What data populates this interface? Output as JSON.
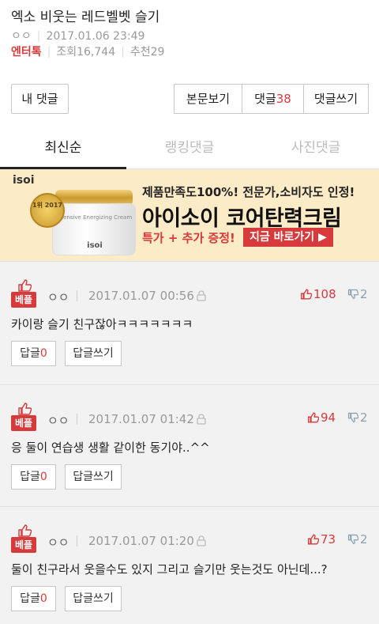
{
  "post": {
    "title": "엑소 비웃는 레드벨벳 슬기",
    "author": "ㅇㅇ",
    "datetime": "2017.01.06 23:49",
    "category": "엔터톡",
    "views_label": "조회16,744",
    "recommend_label": "추천29"
  },
  "buttons": {
    "my_comments": "내 댓글",
    "view_body": "본문보기",
    "comments_label": "댓글",
    "comments_count": "38",
    "write_comment": "댓글쓰기"
  },
  "tabs": [
    {
      "label": "최신순",
      "active": true
    },
    {
      "label": "랭킹댓글",
      "active": false
    },
    {
      "label": "사진댓글",
      "active": false
    }
  ],
  "ad": {
    "brand": "isoi",
    "badge_text": "1위 2017",
    "jar_label": "Intensive Energizing Cream",
    "jar_brand": "isoi",
    "line1": "제품만족도100%! 전문가,소비자도 인정!",
    "line2": "아이소이 코어탄력크림",
    "line3": "특가 + 추가 증정!",
    "cta": "지금 바로가기 ▶"
  },
  "comments": [
    {
      "badge": "베플",
      "author": "ㅇㅇ",
      "datetime": "2017.01.07 00:56",
      "likes": "108",
      "dislikes": "2",
      "text": "카이랑 슬기 친구잖아ㅋㅋㅋㅋㅋㅋㅋ",
      "reply_label": "답글",
      "reply_count": "0",
      "write_reply": "답글쓰기"
    },
    {
      "badge": "베플",
      "author": "ㅇㅇ",
      "datetime": "2017.01.07 01:42",
      "likes": "94",
      "dislikes": "2",
      "text": "응 둘이 연습생 생활 같이한 동기야..^^",
      "reply_label": "답글",
      "reply_count": "0",
      "write_reply": "답글쓰기"
    },
    {
      "badge": "베플",
      "author": "ㅇㅇ",
      "datetime": "2017.01.07 01:20",
      "likes": "73",
      "dislikes": "2",
      "text": "둘이 친구라서 웃을수도 있지 그리고 슬기만 웃는것도 아닌데...?",
      "reply_label": "답글",
      "reply_count": "0",
      "write_reply": "답글쓰기"
    }
  ],
  "colors": {
    "accent": "#d63a3a",
    "ad_background": "#fbebc6",
    "comment_background": "#f2f2f2"
  },
  "icons": [
    "thumb-up-icon",
    "thumb-down-icon",
    "lock-icon"
  ]
}
